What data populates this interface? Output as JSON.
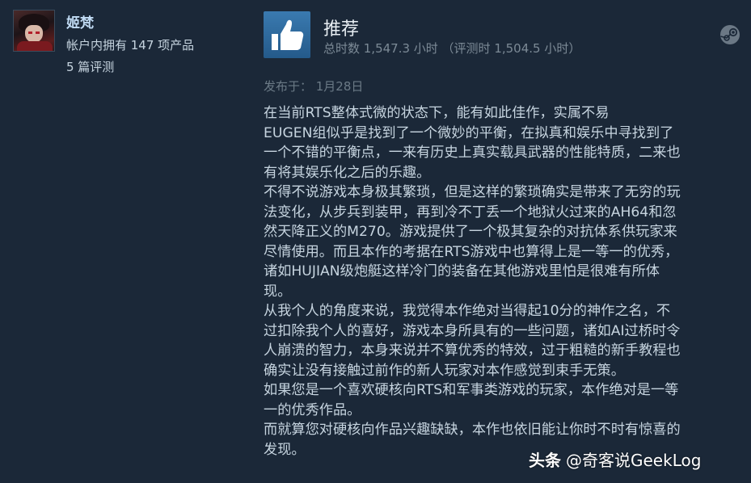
{
  "author": {
    "username": "姬梵",
    "products_owned": "帐户内拥有 147 项产品",
    "review_count": "5 篇评测"
  },
  "review": {
    "verdict": "推荐",
    "verdict_icon": "thumbs-up-icon",
    "hours": "总时数 1,547.3 小时 （评测时 1,504.5 小时）",
    "posted": "发布于：  1月28日",
    "body_lines": [
      "在当前RTS整体式微的状态下，能有如此佳作，实属不易",
      "EUGEN组似乎是找到了一个微妙的平衡，在拟真和娱乐中寻找到了",
      "一个不错的平衡点，一来有历史上真实载具武器的性能特质，二来也",
      "有将其娱乐化之后的乐趣。",
      "不得不说游戏本身极其繁琐，但是这样的繁琐确实是带来了无穷的玩",
      "法变化，从步兵到装甲，再到冷不丁丢一个地狱火过来的AH64和忽",
      "然天降正义的M270。游戏提供了一个极其复杂的对抗体系供玩家来",
      "尽情使用。而且本作的考据在RTS游戏中也算得上是一等一的优秀，",
      "诸如HUJIAN级炮艇这样冷门的装备在其他游戏里怕是很难有所体",
      "现。",
      "从我个人的角度来说，我觉得本作绝对当得起10分的神作之名，不",
      "过扣除我个人的喜好，游戏本身所具有的一些问题，诸如AI过桥时令",
      "人崩溃的智力，本身来说并不算优秀的特效，过于粗糙的新手教程也",
      "确实让没有接触过前作的新人玩家对本作感觉到束手无策。",
      "如果您是一个喜欢硬核向RTS和军事类游戏的玩家，本作绝对是一等",
      "一的优秀作品。",
      "而就算您对硬核向作品兴趣缺缺，本作也依旧能让你时不时有惊喜的",
      "发现。"
    ]
  },
  "watermark": {
    "brand": "头条",
    "handle": "@奇客说GeekLog"
  },
  "colors": {
    "background": "#1b2838",
    "username": "#c1dbf4",
    "text": "#c6d4df",
    "muted": "#7c8a96",
    "verdict_icon_bg": "#2f6ea5"
  }
}
